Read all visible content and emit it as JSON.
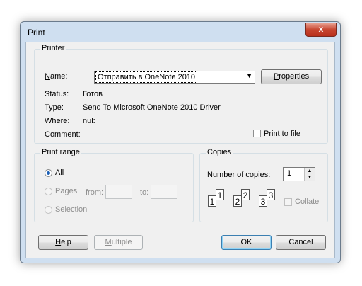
{
  "window": {
    "title": "Print",
    "close_glyph": "x"
  },
  "printer": {
    "legend": "Printer",
    "name_label": "Name:",
    "name_value": "Отправить в OneNote 2010",
    "properties_button": "Properties",
    "status_label": "Status:",
    "status_value": "Готов",
    "type_label": "Type:",
    "type_value": "Send To Microsoft OneNote 2010 Driver",
    "where_label": "Where:",
    "where_value": "nul:",
    "comment_label": "Comment:",
    "print_to_file": "Print to file",
    "print_to_file_checked": false
  },
  "range": {
    "legend": "Print range",
    "all": "All",
    "pages": "Pages",
    "from": "from:",
    "to": "to:",
    "selection": "Selection",
    "selected": "all"
  },
  "copies": {
    "legend": "Copies",
    "number_label": "Number of copies:",
    "number_value": "1",
    "collate": "Collate",
    "collate_checked": false,
    "collate_icon_pages": [
      "1",
      "1",
      "2",
      "2",
      "3",
      "3"
    ]
  },
  "buttons": {
    "help": "Help",
    "multiple": "Multiple",
    "ok": "OK",
    "cancel": "Cancel"
  }
}
